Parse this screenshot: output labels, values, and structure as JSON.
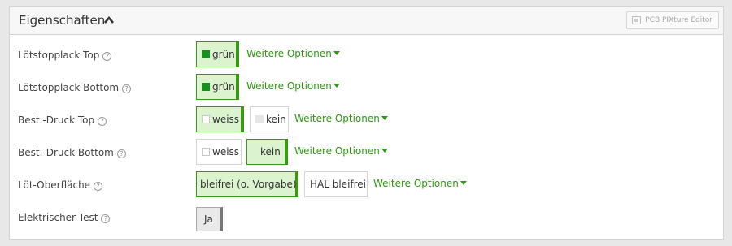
{
  "header": {
    "title": "Eigenschaften",
    "editor_button": "PCB PIXture Editor"
  },
  "rows": [
    {
      "label": "Lötstopplack Top",
      "options": [
        {
          "text": "grün",
          "swatch": "green",
          "selected": true
        }
      ],
      "more": "Weitere Optionen"
    },
    {
      "label": "Lötstopplack Bottom",
      "options": [
        {
          "text": "grün",
          "swatch": "green",
          "selected": true
        }
      ],
      "more": "Weitere Optionen"
    },
    {
      "label": "Best.-Druck Top",
      "options": [
        {
          "text": "weiss",
          "swatch": "white",
          "selected": true
        },
        {
          "text": "kein",
          "swatch": "light",
          "selected": false
        }
      ],
      "more": "Weitere Optionen"
    },
    {
      "label": "Best.-Druck Bottom",
      "options": [
        {
          "text": "weiss",
          "swatch": "white",
          "selected": false
        },
        {
          "text": "kein",
          "swatch": "none",
          "selected": true
        }
      ],
      "more": "Weitere Optionen"
    },
    {
      "label": "Löt-Oberfläche",
      "options": [
        {
          "text": "bleifrei (o. Vorgabe)",
          "selected": true
        },
        {
          "text": "HAL bleifrei",
          "selected": false
        }
      ],
      "more": "Weitere Optionen"
    },
    {
      "label": "Elektrischer Test",
      "options": [
        {
          "text": "Ja",
          "selected": true
        }
      ]
    }
  ],
  "help_glyph": "?",
  "colors": {
    "accent": "#2e9a10",
    "selected_bg": "#dbf3cf",
    "swatch_green": "#17911d"
  }
}
